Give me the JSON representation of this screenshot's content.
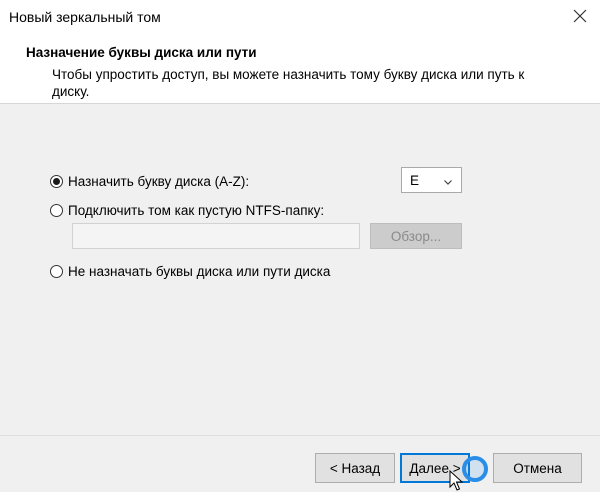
{
  "window": {
    "title": "Новый зеркальный том"
  },
  "header": {
    "heading": "Назначение буквы диска или пути",
    "description": "Чтобы упростить доступ, вы можете назначить тому букву диска или путь к диску."
  },
  "options": {
    "assign_letter": {
      "label": "Назначить букву диска (A-Z):",
      "checked": true
    },
    "mount_folder": {
      "label": "Подключить том как пустую NTFS-папку:",
      "checked": false
    },
    "no_assign": {
      "label": "Не назначать буквы диска или пути диска",
      "checked": false
    }
  },
  "drive_letter": {
    "selected": "E"
  },
  "folder_path": {
    "value": ""
  },
  "browse_button": {
    "label": "Обзор..."
  },
  "footer": {
    "back_label": "< Назад",
    "next_label": "Далее >",
    "cancel_label": "Отмена"
  },
  "icons": {
    "close": "close-icon",
    "dropdown": "chevron-down-icon",
    "cursor": "mouse-pointer-icon",
    "click": "click-indicator-icon"
  },
  "colors": {
    "accent": "#0078d7",
    "click_ring": "#2a8ee8"
  }
}
